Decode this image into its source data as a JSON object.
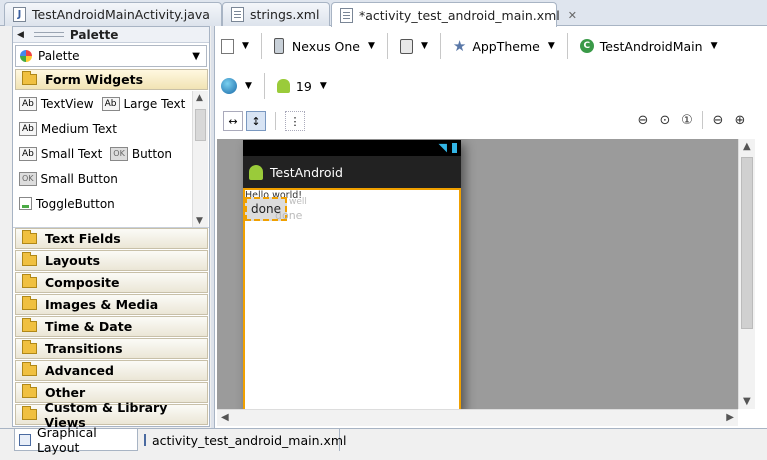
{
  "editor_tabs": [
    {
      "label": "TestAndroidMainActivity.java",
      "icon": "java-file-icon"
    },
    {
      "label": "strings.xml",
      "icon": "xml-file-icon"
    },
    {
      "label": "*activity_test_android_main.xml",
      "icon": "xml-file-icon",
      "close": "✕"
    }
  ],
  "palette": {
    "title": "Palette",
    "selector_value": "Palette",
    "open_category": "Form Widgets",
    "widgets": [
      [
        "TextView",
        "Large Text"
      ],
      [
        "Medium Text"
      ],
      [
        "Small Text",
        "Button"
      ],
      [
        "Small Button"
      ],
      [
        "ToggleButton"
      ]
    ],
    "widget_icon_text": {
      "ab": "Ab",
      "ok": "OK"
    },
    "categories": [
      "Text Fields",
      "Layouts",
      "Composite",
      "Images & Media",
      "Time & Date",
      "Transitions",
      "Advanced",
      "Other",
      "Custom & Library Views"
    ]
  },
  "toolbar": {
    "device": "Nexus One",
    "theme": "AppTheme",
    "activity": "TestAndroidMain",
    "api_level": "19"
  },
  "preview": {
    "app_title": "TestAndroid",
    "hello_text": "Hello world!",
    "button_label": "done",
    "ghost_hint": "well",
    "ghost_button": "done"
  },
  "bottom_tabs": [
    {
      "label": "Graphical Layout"
    },
    {
      "label": "activity_test_android_main.xml"
    }
  ],
  "colors": {
    "selection": "#f0a000",
    "action_bar": "#222222",
    "canvas": "#9b9b9b"
  }
}
